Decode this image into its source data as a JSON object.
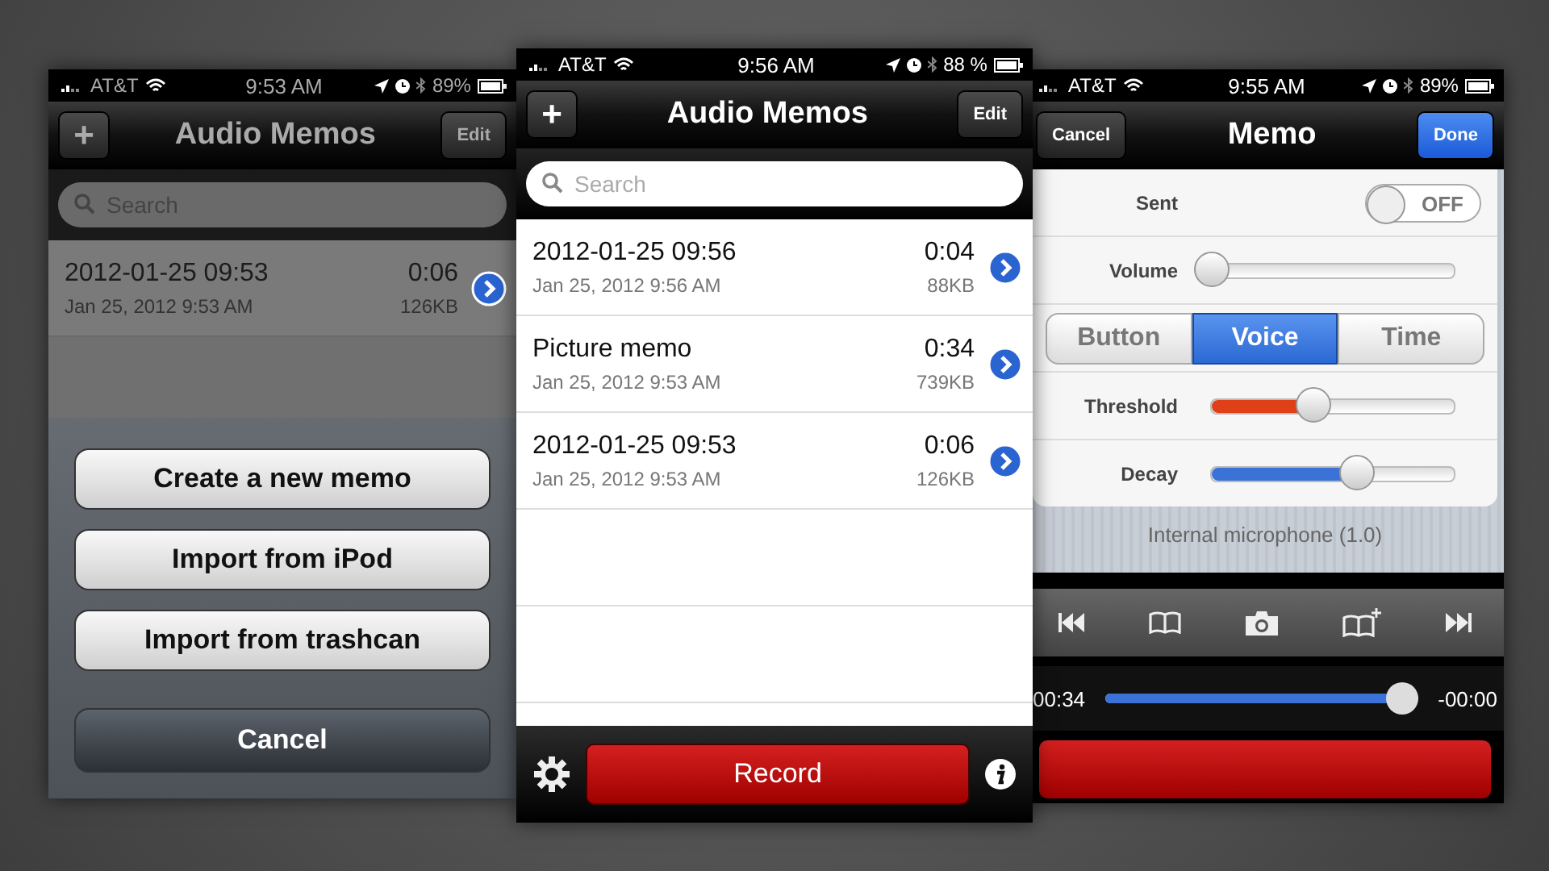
{
  "left_phone": {
    "status": {
      "carrier": "AT&T",
      "time": "9:53 AM",
      "battery": "89%"
    },
    "nav": {
      "add": "+",
      "title": "Audio Memos",
      "edit": "Edit"
    },
    "search": {
      "placeholder": "Search"
    },
    "rows": [
      {
        "name": "2012-01-25 09:53",
        "date": "Jan 25, 2012 9:53 AM",
        "length": "0:06",
        "size": "126KB"
      }
    ],
    "sheet": {
      "actions": [
        "Create a new memo",
        "Import from iPod",
        "Import from trashcan"
      ],
      "cancel": "Cancel"
    }
  },
  "center_phone": {
    "status": {
      "carrier": "AT&T",
      "time": "9:56 AM",
      "battery": "88 %"
    },
    "nav": {
      "add": "+",
      "title": "Audio Memos",
      "edit": "Edit"
    },
    "search": {
      "placeholder": "Search"
    },
    "rows": [
      {
        "name": "2012-01-25 09:56",
        "date": "Jan 25, 2012 9:56 AM",
        "length": "0:04",
        "size": "88KB"
      },
      {
        "name": "Picture memo",
        "date": "Jan 25, 2012 9:53 AM",
        "length": "0:34",
        "size": "739KB"
      },
      {
        "name": "2012-01-25 09:53",
        "date": "Jan 25, 2012 9:53 AM",
        "length": "0:06",
        "size": "126KB"
      }
    ],
    "record": "Record"
  },
  "right_phone": {
    "status": {
      "carrier": "AT&T",
      "time": "9:55 AM",
      "battery": "89%"
    },
    "nav": {
      "cancel": "Cancel",
      "title": "Memo",
      "done": "Done"
    },
    "sent": {
      "label": "Sent",
      "toggle": "OFF",
      "on": false
    },
    "volume": {
      "label": "Volume",
      "level": 0.0
    },
    "segments": [
      {
        "label": "Button",
        "selected": false
      },
      {
        "label": "Voice",
        "selected": true
      },
      {
        "label": "Time",
        "selected": false
      }
    ],
    "threshold": {
      "label": "Threshold",
      "level": 0.42
    },
    "decay": {
      "label": "Decay",
      "level": 0.6
    },
    "input": "Internal microphone (1.0)",
    "player": {
      "elapsed": "00:34",
      "remaining": "-00:00",
      "level": 0.95
    }
  }
}
